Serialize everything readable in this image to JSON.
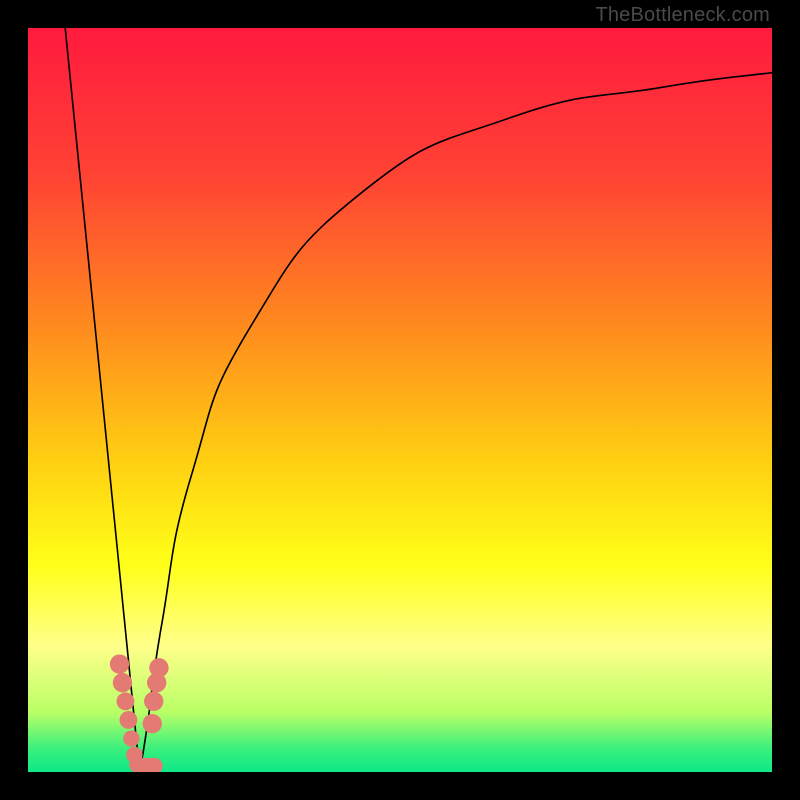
{
  "attribution": "TheBottleneck.com",
  "colors": {
    "frame": "#000000",
    "curve": "#000000",
    "points": "#e47a74",
    "text": "#4a4a4a"
  },
  "chart_data": {
    "type": "line",
    "title": "",
    "xlabel": "",
    "ylabel": "",
    "xlim": [
      0,
      100
    ],
    "ylim": [
      0,
      100
    ],
    "grid": false,
    "legend": false,
    "background_gradient_stops": [
      {
        "pct": 0.0,
        "color": "#ff1a3e"
      },
      {
        "pct": 0.2,
        "color": "#ff4334"
      },
      {
        "pct": 0.4,
        "color": "#ff8a1e"
      },
      {
        "pct": 0.58,
        "color": "#ffcf12"
      },
      {
        "pct": 0.72,
        "color": "#ffff18"
      },
      {
        "pct": 0.83,
        "color": "#ffff8a"
      },
      {
        "pct": 0.92,
        "color": "#b9ff66"
      },
      {
        "pct": 0.97,
        "color": "#37ef7d"
      },
      {
        "pct": 1.0,
        "color": "#0ee888"
      }
    ],
    "series": [
      {
        "name": "left-branch",
        "type": "line",
        "points": [
          {
            "x": 5.0,
            "y": 100.0
          },
          {
            "x": 7.0,
            "y": 80.0
          },
          {
            "x": 9.0,
            "y": 60.0
          },
          {
            "x": 11.0,
            "y": 40.0
          },
          {
            "x": 13.0,
            "y": 20.0
          },
          {
            "x": 14.5,
            "y": 5.0
          },
          {
            "x": 15.0,
            "y": 0.0
          }
        ]
      },
      {
        "name": "right-branch",
        "type": "line",
        "points": [
          {
            "x": 15.0,
            "y": 0.0
          },
          {
            "x": 16.0,
            "y": 6.0
          },
          {
            "x": 18.0,
            "y": 20.0
          },
          {
            "x": 22.0,
            "y": 40.0
          },
          {
            "x": 30.0,
            "y": 60.0
          },
          {
            "x": 45.0,
            "y": 78.0
          },
          {
            "x": 65.0,
            "y": 88.0
          },
          {
            "x": 85.0,
            "y": 92.0
          },
          {
            "x": 100.0,
            "y": 94.0
          }
        ]
      }
    ],
    "scatter": {
      "name": "points",
      "color": "#e47a74",
      "points": [
        {
          "x": 12.3,
          "y": 14.5,
          "r": 1.3
        },
        {
          "x": 12.7,
          "y": 12.0,
          "r": 1.3
        },
        {
          "x": 13.1,
          "y": 9.5,
          "r": 1.2
        },
        {
          "x": 13.5,
          "y": 7.0,
          "r": 1.2
        },
        {
          "x": 13.9,
          "y": 4.5,
          "r": 1.1
        },
        {
          "x": 14.3,
          "y": 2.3,
          "r": 1.1
        },
        {
          "x": 14.7,
          "y": 1.0,
          "r": 1.1
        },
        {
          "x": 15.2,
          "y": 0.8,
          "r": 1.1
        },
        {
          "x": 15.8,
          "y": 0.8,
          "r": 1.1
        },
        {
          "x": 16.4,
          "y": 0.8,
          "r": 1.1
        },
        {
          "x": 17.0,
          "y": 0.8,
          "r": 1.1
        },
        {
          "x": 16.7,
          "y": 6.5,
          "r": 1.3
        },
        {
          "x": 16.9,
          "y": 9.5,
          "r": 1.3
        },
        {
          "x": 17.3,
          "y": 12.0,
          "r": 1.3
        },
        {
          "x": 17.6,
          "y": 14.0,
          "r": 1.3
        }
      ]
    }
  }
}
